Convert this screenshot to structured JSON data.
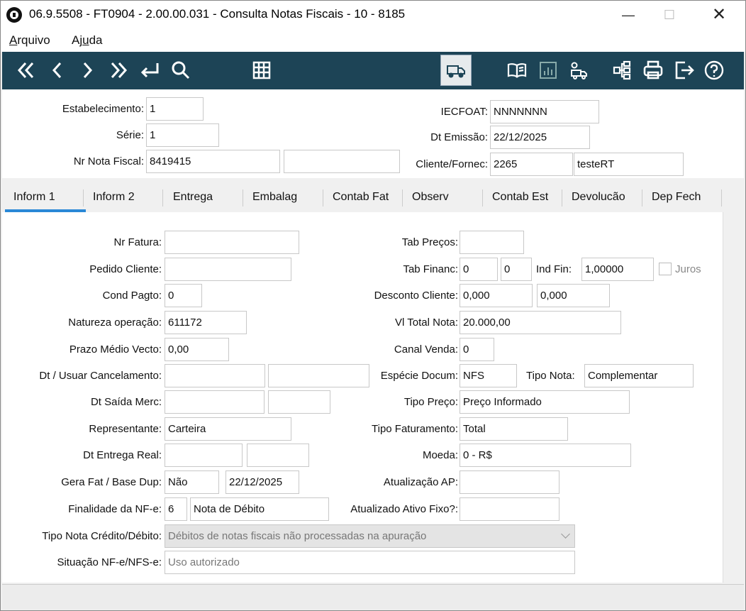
{
  "window": {
    "title": "06.9.5508 - FT0904 - 2.00.00.031 - Consulta Notas Fiscais - 10 - 8185"
  },
  "menu": {
    "arquivo": "Arquivo",
    "ajuda": "Ajuda"
  },
  "header": {
    "estabelecimento_label": "Estabelecimento:",
    "estabelecimento_value": "1",
    "serie_label": "Série:",
    "serie_value": "1",
    "nr_nota_label": "Nr Nota Fiscal:",
    "nr_nota_value": "8419415",
    "nr_nota_extra": "",
    "iecfoat_label": "IECFOAT:",
    "iecfoat_value": "NNNNNNN",
    "dt_emissao_label": "Dt Emissão:",
    "dt_emissao_value": "22/12/2025",
    "cliente_label": "Cliente/Fornec:",
    "cliente_code": "2265",
    "cliente_name": "testeRT"
  },
  "tabs": [
    "Inform 1",
    "Inform 2",
    "Entrega",
    "Embalag",
    "Contab Fat",
    "Observ",
    "Contab Est",
    "Devolucão",
    "Dep Fech"
  ],
  "left": {
    "nr_fatura_label": "Nr Fatura:",
    "nr_fatura": "",
    "pedido_label": "Pedido Cliente:",
    "pedido": "",
    "cond_label": "Cond Pagto:",
    "cond": "0",
    "natureza_label": "Natureza operação:",
    "natureza": "611172",
    "prazo_label": "Prazo Médio Vecto:",
    "prazo": "0,00",
    "cancel_label": "Dt / Usuar Cancelamento:",
    "cancel_dt": "",
    "cancel_user": "",
    "saida_label": "Dt Saída Merc:",
    "saida_dt": "",
    "saida_hr": "",
    "repres_label": "Representante:",
    "repres": "Carteira",
    "entrega_label": "Dt Entrega Real:",
    "entrega_dt": "",
    "entrega_hr": "",
    "gerafat_label": "Gera Fat / Base Dup:",
    "gerafat": "Não",
    "base_dup": "22/12/2025",
    "finalidade_label": "Finalidade da NF-e:",
    "finalidade_code": "6",
    "finalidade_desc": "Nota de Débito",
    "tipo_cred_label": "Tipo Nota Crédito/Débito:",
    "tipo_cred": "Débitos de notas fiscais não processadas na apuração",
    "situacao_label": "Situação NF-e/NFS-e:",
    "situacao": "Uso autorizado"
  },
  "right": {
    "tab_precos_label": "Tab Preços:",
    "tab_precos": "",
    "tab_financ_label": "Tab Financ:",
    "tab_financ_1": "0",
    "tab_financ_2": "0",
    "ind_fin_label": "Ind Fin:",
    "ind_fin": "1,00000",
    "juros_label": "Juros",
    "desconto_label": "Desconto Cliente:",
    "desconto_1": "0,000",
    "desconto_2": "0,000",
    "vl_total_label": "Vl Total Nota:",
    "vl_total": "20.000,00",
    "canal_label": "Canal Venda:",
    "canal": "0",
    "especie_label": "Espécie Docum:",
    "especie": "NFS",
    "tipo_nota_label": "Tipo Nota:",
    "tipo_nota": "Complementar",
    "tipo_preco_label": "Tipo Preço:",
    "tipo_preco": "Preço Informado",
    "tipo_fat_label": "Tipo Faturamento:",
    "tipo_fat": "Total",
    "moeda_label": "Moeda:",
    "moeda": "0 - R$",
    "atual_ap_label": "Atualização AP:",
    "atual_ap": "",
    "atual_ativo_label": "Atualizado Ativo Fixo?:",
    "atual_ativo": ""
  }
}
